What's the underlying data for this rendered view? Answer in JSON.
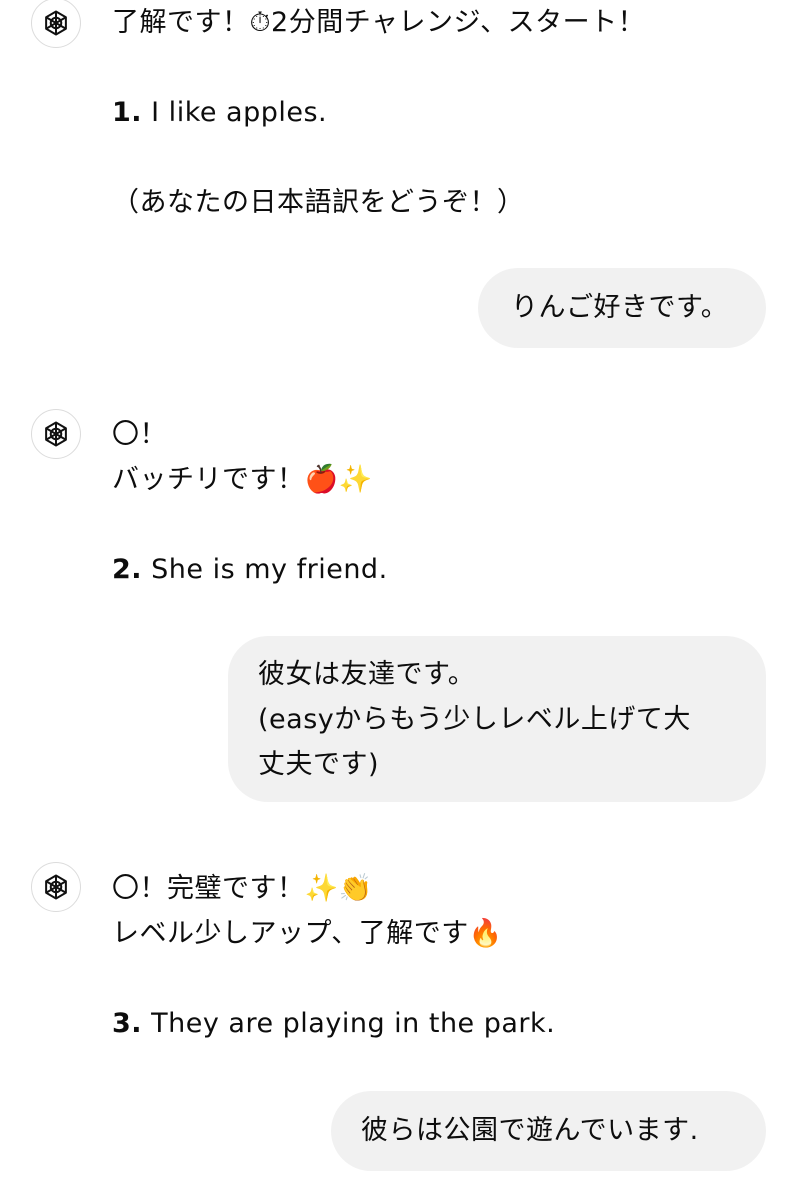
{
  "messages": [
    {
      "role": "assistant",
      "icon": "openai-logo-icon",
      "lines": [
        "了解です！⏱2分間チャレンジ、スタート！"
      ],
      "prompt_number": "1.",
      "prompt_sentence": "I like apples.",
      "note": "（あなたの日本語訳をどうぞ！）"
    },
    {
      "role": "user",
      "lines": [
        "りんご好きです。"
      ]
    },
    {
      "role": "assistant",
      "icon": "openai-logo-icon",
      "lines": [
        "〇！",
        "バッチリです！🍎✨"
      ],
      "prompt_number": "2.",
      "prompt_sentence": "She is my friend."
    },
    {
      "role": "user",
      "lines": [
        "彼女は友達です。",
        "(easyからもう少しレベル上げて大",
        "丈夫です)"
      ]
    },
    {
      "role": "assistant",
      "icon": "openai-logo-icon",
      "lines": [
        "〇！完璧です！✨👏",
        "レベル少しアップ、了解です🔥"
      ],
      "prompt_number": "3.",
      "prompt_sentence": "They are playing in the park."
    },
    {
      "role": "user",
      "lines": [
        "彼らは公園で遊んでいます."
      ]
    }
  ],
  "colors": {
    "user_bubble": "#f1f1f1",
    "text": "#0d0d0d",
    "avatar_border": "#dcdcdc"
  }
}
